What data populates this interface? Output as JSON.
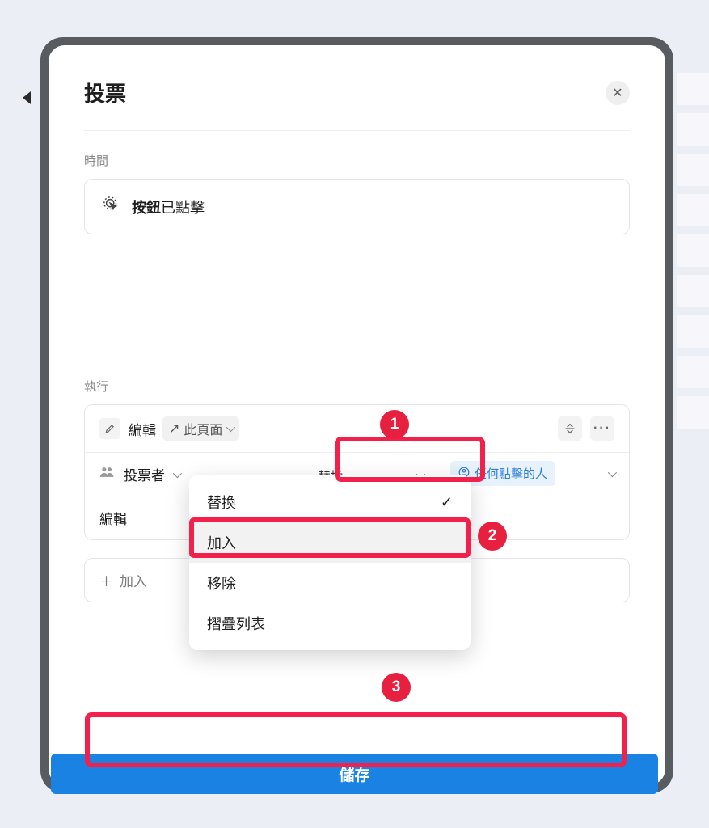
{
  "modal": {
    "title": "投票",
    "close_aria": "close"
  },
  "section_time_label": "時間",
  "trigger": {
    "bold": "按鈕",
    "rest": "已點擊"
  },
  "section_action_label": "執行",
  "action_head": {
    "edit_label": "編輯",
    "page_chip": "此頁面"
  },
  "voter_row": {
    "label": "投票者",
    "select_value": "替換",
    "chip": "任何點擊的人"
  },
  "edit_row_label": "編輯",
  "add_action_label": "加入",
  "menu": {
    "items": [
      "替換",
      "加入",
      "移除",
      "摺疊列表"
    ],
    "checked_index": 0,
    "hovered_index": 1
  },
  "save_label": "儲存",
  "badges": [
    "1",
    "2",
    "3"
  ]
}
